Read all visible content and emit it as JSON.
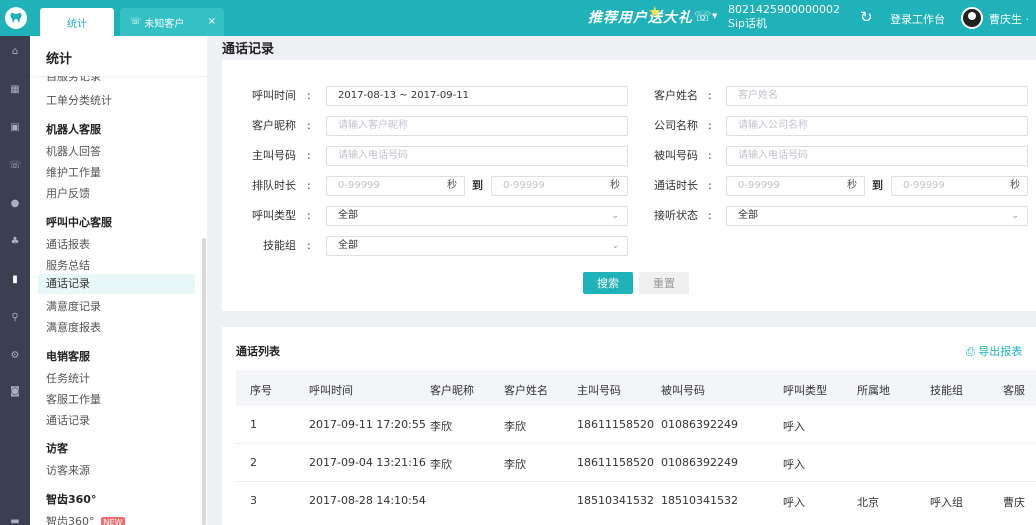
{
  "topbar": {
    "tabs": [
      {
        "label": "统计"
      },
      {
        "label": "未知客户"
      }
    ],
    "tab_close": "×",
    "promo": "推荐用户送大礼",
    "phone_number": "8021425900000002",
    "phone_sub": "Sip话机",
    "login_workbench": "登录工作台",
    "username": "曹庆生 ·"
  },
  "sidebar": {
    "title": "统计",
    "cut_item": "自服务记录",
    "groups": [
      {
        "title": "",
        "items": [
          "工单分类统计"
        ]
      },
      {
        "title": "机器人客服",
        "items": [
          "机器人回答",
          "维护工作量",
          "用户反馈"
        ]
      },
      {
        "title": "呼叫中心客服",
        "items": [
          "通话报表",
          "服务总结",
          "通话记录",
          "满意度记录",
          "满意度报表"
        ]
      },
      {
        "title": "电销客服",
        "items": [
          "任务统计",
          "客服工作量",
          "通话记录"
        ]
      },
      {
        "title": "访客",
        "items": [
          "访客来源"
        ]
      },
      {
        "title": "智齿360°",
        "items": [
          "智齿360°"
        ]
      }
    ],
    "new_badge": "NEW",
    "active_item": "通话记录"
  },
  "page": {
    "title": "通话记录"
  },
  "filters": {
    "call_time": {
      "label": "呼叫时间",
      "value": "2017-08-13 ~ 2017-09-11"
    },
    "customer_name": {
      "label": "客户姓名",
      "placeholder": "客户姓名"
    },
    "nickname": {
      "label": "客户昵称",
      "placeholder": "请输入客户昵称"
    },
    "company": {
      "label": "公司名称",
      "placeholder": "请输入公司名称"
    },
    "caller": {
      "label": "主叫号码",
      "placeholder": "请输入电话号码"
    },
    "callee": {
      "label": "被叫号码",
      "placeholder": "请输入电话号码"
    },
    "queue_time": {
      "label": "排队时长",
      "min_placeholder": "0-99999",
      "max_placeholder": "0-99999",
      "unit": "秒",
      "to": "到"
    },
    "talk_time": {
      "label": "通话时长",
      "min_placeholder": "0-99999",
      "max_placeholder": "0-99999",
      "unit": "秒",
      "to": "到"
    },
    "call_type": {
      "label": "呼叫类型",
      "value": "全部"
    },
    "answer_status": {
      "label": "接听状态",
      "value": "全部"
    },
    "skill_group": {
      "label": "技能组",
      "value": "全部"
    },
    "colon": ":",
    "search_label": "搜索",
    "reset_label": "重置"
  },
  "list": {
    "title": "通话列表",
    "export_label": "导出报表",
    "columns": [
      "序号",
      "呼叫时间",
      "客户昵称",
      "客户姓名",
      "主叫号码",
      "被叫号码",
      "呼叫类型",
      "所属地",
      "技能组",
      "客服"
    ],
    "rows": [
      [
        "1",
        "2017-09-11 17:20:55",
        "李欣",
        "李欣",
        "18611158520",
        "01086392249",
        "呼入",
        "",
        "",
        ""
      ],
      [
        "2",
        "2017-09-04 13:21:16",
        "李欣",
        "李欣",
        "18611158520",
        "01086392249",
        "呼入",
        "",
        "",
        ""
      ],
      [
        "3",
        "2017-08-28 14:10:54",
        "",
        "",
        "18510341532",
        "18510341532",
        "呼入",
        "北京",
        "呼入组",
        "曹庆"
      ]
    ]
  },
  "icons": [
    "tooth-logo-icon",
    "phone-icon",
    "refresh-icon",
    "home-icon",
    "grid-icon",
    "doc-icon",
    "user-icon",
    "team-icon",
    "chart-icon",
    "search-icon",
    "gear-icon",
    "camera-icon",
    "export-icon",
    "chevron-down-icon"
  ]
}
